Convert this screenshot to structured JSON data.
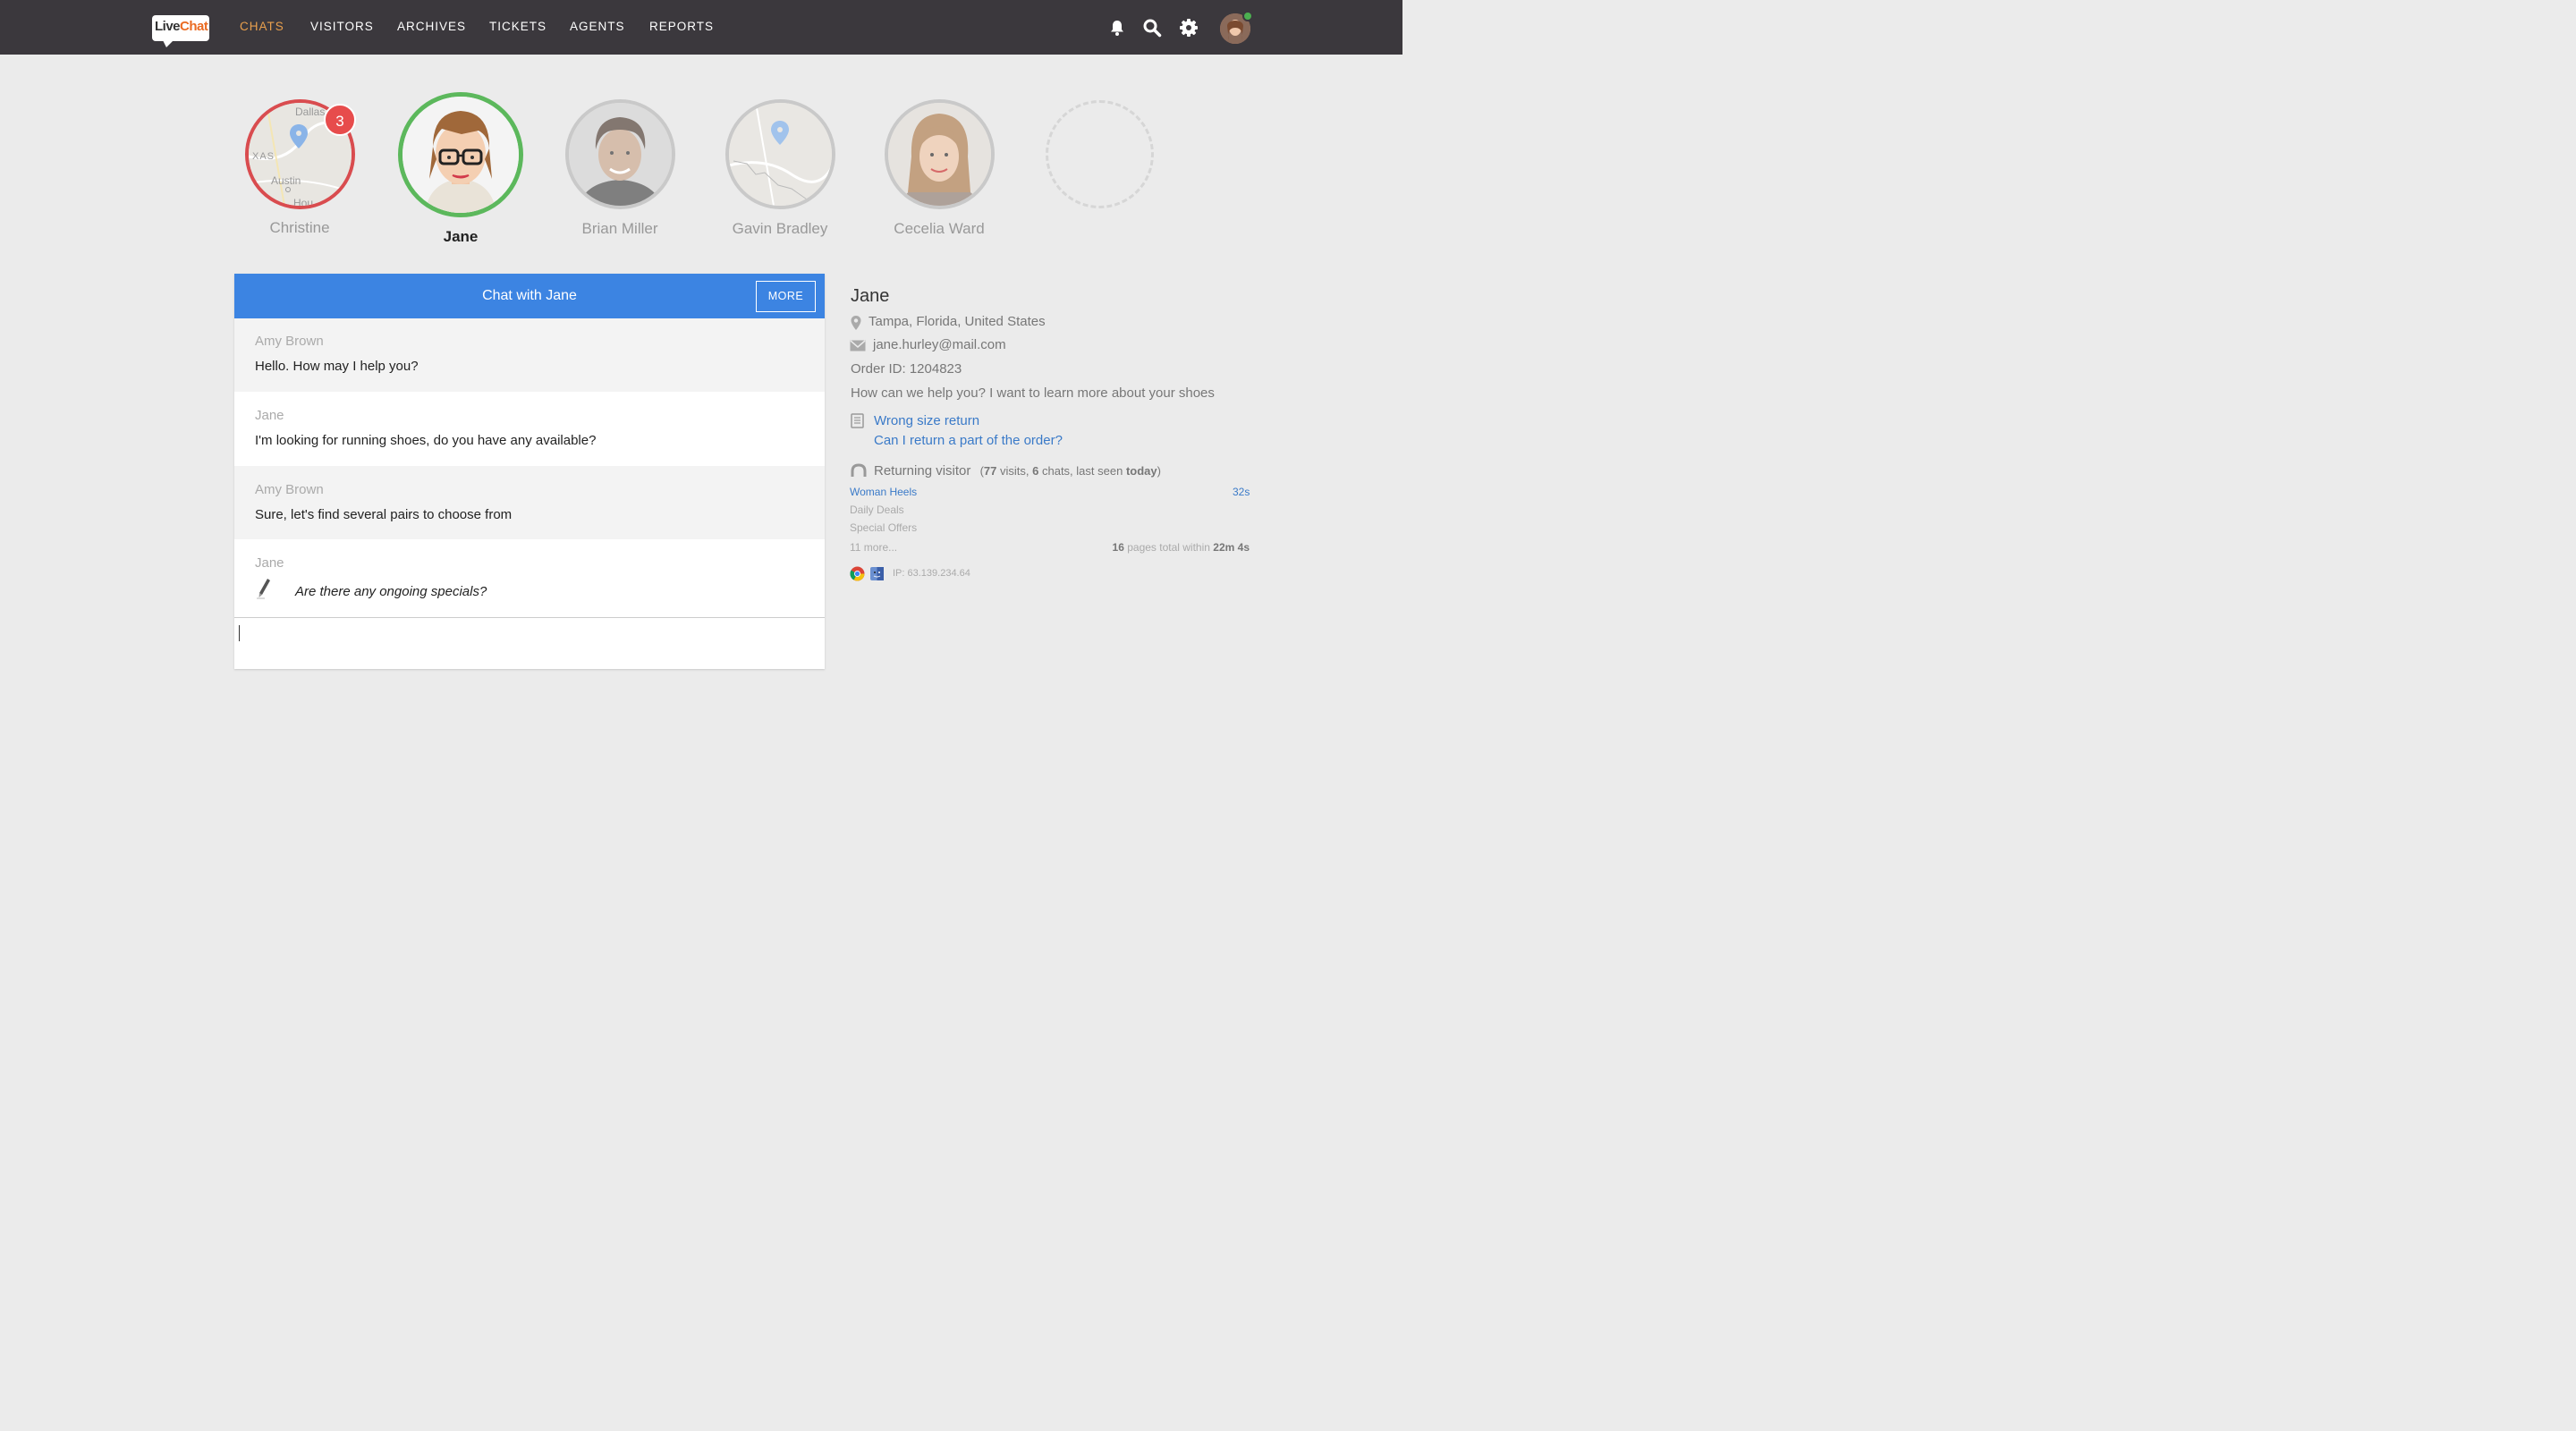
{
  "nav": {
    "logo_part1": "Live",
    "logo_part2": "Chat",
    "links": [
      "CHATS",
      "VISITORS",
      "ARCHIVES",
      "TICKETS",
      "AGENTS",
      "REPORTS"
    ],
    "active_index": 0,
    "icons": [
      "bell-icon",
      "search-icon",
      "gear-icon"
    ],
    "status_color": "#4caf50"
  },
  "chats": [
    {
      "name": "Christine",
      "badge": "3",
      "state": "unread",
      "ring_color": "#d94c4f"
    },
    {
      "name": "Jane",
      "state": "active",
      "ring_color": "#5cb85c"
    },
    {
      "name": "Brian Miller",
      "state": "idle",
      "ring_color": "#c9c9c9"
    },
    {
      "name": "Gavin Bradley",
      "state": "idle",
      "ring_color": "#c9c9c9"
    },
    {
      "name": "Cecelia Ward",
      "state": "idle",
      "ring_color": "#c9c9c9"
    }
  ],
  "map_labels": {
    "city1": "Dallas",
    "state": "XAS",
    "city2": "Austin",
    "city3": "Hou"
  },
  "chat": {
    "title": "Chat with Jane",
    "more_label": "MORE",
    "messages": [
      {
        "author": "Amy Brown",
        "text": "Hello. How may I help you?"
      },
      {
        "author": "Jane",
        "text": "I'm looking for running shoes, do you have any available?"
      },
      {
        "author": "Amy Brown",
        "text": "Sure, let's find several pairs to choose from"
      },
      {
        "author": "Jane",
        "text": "Are there any ongoing specials?",
        "typing": true
      }
    ]
  },
  "visitor": {
    "name": "Jane",
    "location": "Tampa, Florida, United States",
    "email": "jane.hurley@mail.com",
    "order": "Order ID: 1204823",
    "question": "How can we help you? I want to learn more about your shoes",
    "tickets": [
      "Wrong size return",
      "Can I return a part of the order?"
    ],
    "returning_label": "Returning visitor",
    "visits": "77",
    "visits_label": "visits,",
    "chats_count": "6",
    "chats_label": "chats, last seen",
    "last_seen": "today",
    "pages": [
      {
        "title": "Woman Heels",
        "time": "32s"
      },
      {
        "title": "Daily Deals"
      },
      {
        "title": "Special Offers"
      }
    ],
    "more_pages": "11 more...",
    "pages_total": "16",
    "pages_total_label": "pages total within",
    "duration": "22m 4s",
    "ip": "IP: 63.139.234.64"
  },
  "colors": {
    "nav_bg": "#3b383d",
    "active_nav": "#e9a04d",
    "chat_header": "#3c84e2",
    "link": "#3a7ac8"
  }
}
